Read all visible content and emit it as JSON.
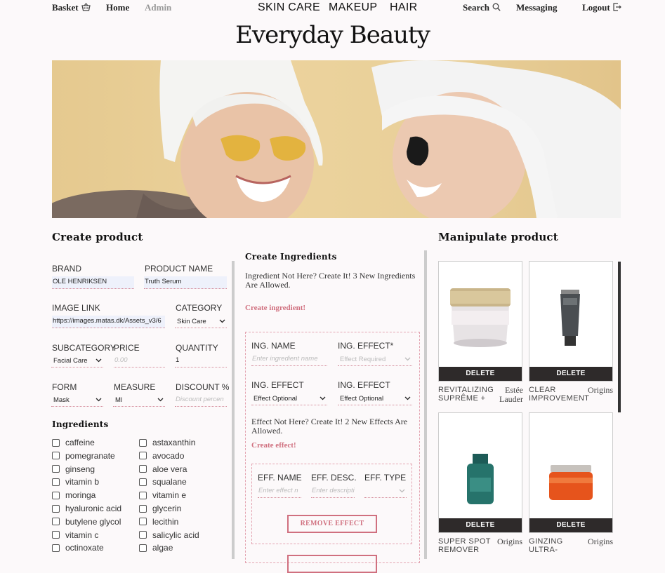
{
  "nav": {
    "basket": "Basket",
    "home": "Home",
    "admin": "Admin",
    "categories": [
      "SKIN CARE",
      "MAKEUP",
      "HAIR"
    ],
    "search": "Search",
    "messaging": "Messaging",
    "logout": "Logout"
  },
  "brand_title": "Everyday Beauty",
  "create_product": {
    "title": "Create product",
    "brand_label": "BRAND",
    "brand_value": "OLE HENRIKSEN",
    "product_name_label": "PRODUCT NAME",
    "product_name_value": "Truth Serum",
    "image_link_label": "IMAGE LINK",
    "image_link_value": "https://images.matas.dk/Assets_v3/6",
    "category_label": "CATEGORY",
    "category_value": "Skin Care",
    "subcategory_label": "SUBCATEGORY",
    "subcategory_value": "Facial Care",
    "price_label": "PRICE",
    "price_placeholder": "0.00",
    "quantity_label": "QUANTITY",
    "quantity_value": "1",
    "form_label": "FORM",
    "form_value": "Mask",
    "measure_label": "MEASURE",
    "measure_value": "Ml",
    "discount_label": "DISCOUNT %",
    "discount_placeholder": "Discount percen",
    "ingredients_title": "Ingredients",
    "ingredients_left": [
      "caffeine",
      "pomegranate",
      "ginseng",
      "vitamin b",
      "moringa",
      "hyaluronic acid",
      "butylene glycol",
      "vitamin c",
      "octinoxate"
    ],
    "ingredients_right": [
      "astaxanthin",
      "avocado",
      "aloe vera",
      "squalane",
      "vitamin e",
      "glycerin",
      "lecithin",
      "salicylic acid",
      "algae"
    ]
  },
  "create_ingredients": {
    "title": "Create Ingredients",
    "info": "Ingredient Not Here? Create It! 3 New Ingredients Are Allowed.",
    "create_link": "Create ingredient!",
    "ing_name_label": "ING. NAME",
    "ing_name_placeholder": "Enter ingredient name",
    "ing_effect_req_label": "ING. EFFECT*",
    "ing_effect_req_placeholder": "Effect Required",
    "ing_effect_label_1": "ING. EFFECT",
    "ing_effect_value_1": "Effect Optional",
    "ing_effect_label_2": "ING. EFFECT",
    "ing_effect_value_2": "Effect Optional",
    "effect_info": "Effect Not Here? Create It! 2 New Effects Are Allowed.",
    "create_effect": "Create effect!",
    "eff_name_label": "EFF. NAME",
    "eff_name_placeholder": "Enter effect n",
    "eff_desc_label": "EFF. DESC.",
    "eff_desc_placeholder": "Enter descripti",
    "eff_type_label": "EFF. TYPE",
    "remove_effect": "REMOVE EFFECT"
  },
  "manipulate": {
    "title": "Manipulate product",
    "delete_label": "DELETE",
    "products": [
      {
        "name_line1": "REVITALIZING",
        "name_line2": "SUPRÊME +",
        "brand_line1": "Estée",
        "brand_line2": "Lauder"
      },
      {
        "name_line1": "CLEAR",
        "name_line2": "IMPROVEMENT",
        "brand_line1": "Origins",
        "brand_line2": ""
      },
      {
        "name_line1": "SUPER SPOT",
        "name_line2": "REMOVER",
        "brand_line1": "Origins",
        "brand_line2": ""
      },
      {
        "name_line1": "GINZING",
        "name_line2": "ULTRA-",
        "brand_line1": "Origins",
        "brand_line2": ""
      }
    ]
  },
  "colors": {
    "accent_pink": "#d0707f",
    "dark": "#2e2a2a",
    "input_bg": "#eef1fb"
  }
}
